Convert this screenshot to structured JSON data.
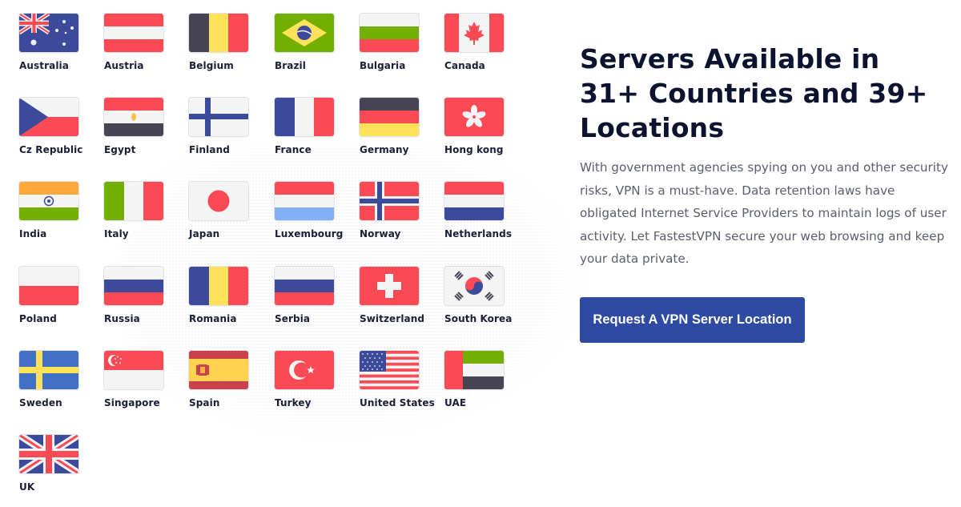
{
  "colors": {
    "heading": "#0c1330",
    "body_text": "#5a5f6d",
    "button_bg": "#2e4aa3",
    "button_text": "#ffffff",
    "flag_red": "#fc4a55",
    "flag_blue": "#3b4a9a",
    "flag_white": "#f4f4f5",
    "flag_dark": "#474554",
    "flag_yellow": "#ffe15a",
    "flag_green": "#73af00"
  },
  "countries": [
    {
      "name": "Australia",
      "icon": "australia-flag-icon"
    },
    {
      "name": "Austria",
      "icon": "austria-flag-icon"
    },
    {
      "name": "Belgium",
      "icon": "belgium-flag-icon"
    },
    {
      "name": "Brazil",
      "icon": "brazil-flag-icon"
    },
    {
      "name": "Bulgaria",
      "icon": "bulgaria-flag-icon"
    },
    {
      "name": "Canada",
      "icon": "canada-flag-icon"
    },
    {
      "name": "Cz Republic",
      "icon": "czech-republic-flag-icon"
    },
    {
      "name": "Egypt",
      "icon": "egypt-flag-icon"
    },
    {
      "name": "Finland",
      "icon": "finland-flag-icon"
    },
    {
      "name": "France",
      "icon": "france-flag-icon"
    },
    {
      "name": "Germany",
      "icon": "germany-flag-icon"
    },
    {
      "name": "Hong kong",
      "icon": "hong-kong-flag-icon"
    },
    {
      "name": "India",
      "icon": "india-flag-icon"
    },
    {
      "name": "Italy",
      "icon": "italy-flag-icon"
    },
    {
      "name": "Japan",
      "icon": "japan-flag-icon"
    },
    {
      "name": "Luxembourg",
      "icon": "luxembourg-flag-icon"
    },
    {
      "name": "Norway",
      "icon": "norway-flag-icon"
    },
    {
      "name": "Netherlands",
      "icon": "netherlands-flag-icon"
    },
    {
      "name": "Poland",
      "icon": "poland-flag-icon"
    },
    {
      "name": "Russia",
      "icon": "russia-flag-icon"
    },
    {
      "name": "Romania",
      "icon": "romania-flag-icon"
    },
    {
      "name": "Serbia",
      "icon": "serbia-flag-icon"
    },
    {
      "name": "Switzerland",
      "icon": "switzerland-flag-icon"
    },
    {
      "name": "South Korea",
      "icon": "south-korea-flag-icon"
    },
    {
      "name": "Sweden",
      "icon": "sweden-flag-icon"
    },
    {
      "name": "Singapore",
      "icon": "singapore-flag-icon"
    },
    {
      "name": "Spain",
      "icon": "spain-flag-icon"
    },
    {
      "name": "Turkey",
      "icon": "turkey-flag-icon"
    },
    {
      "name": "United States",
      "icon": "united-states-flag-icon"
    },
    {
      "name": "UAE",
      "icon": "uae-flag-icon"
    },
    {
      "name": "UK",
      "icon": "uk-flag-icon"
    }
  ],
  "content": {
    "heading": "Servers Available in 31+ Countries and 39+ Locations",
    "description": "With government agencies spying on you and other security risks, VPN is a must-have. Data retention laws have obligated Internet Service Providers to maintain logs of user activity. Let FastestVPN secure your web browsing and keep your data private.",
    "button_label": "Request A VPN Server Location"
  }
}
